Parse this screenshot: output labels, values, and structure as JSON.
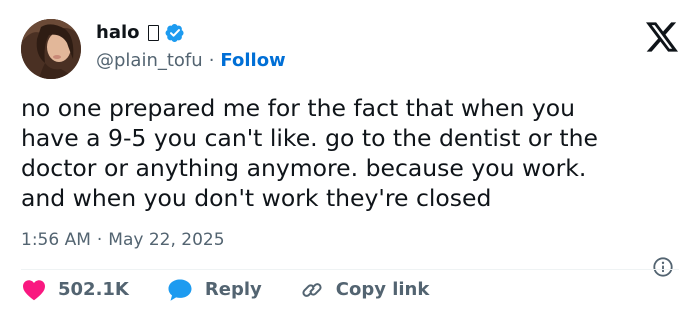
{
  "user": {
    "display_name": "halo",
    "handle": "@plain_tofu",
    "separator": "·",
    "follow_label": "Follow"
  },
  "tweet": {
    "text": "no one prepared me for the fact that when you\nhave a 9-5 you can't like. go to the dentist or the\ndoctor or anything anymore. because you work.\nand when you don't work they're closed",
    "time": "1:56 AM",
    "separator": "·",
    "date": "May 22, 2025"
  },
  "actions": {
    "like_count": "502.1K",
    "reply_label": "Reply",
    "copy_label": "Copy link"
  },
  "colors": {
    "text": "#0f1419",
    "secondary": "#536471",
    "link": "#006fd6",
    "like": "#f91880",
    "reply": "#1d9bf0",
    "verified": "#1d9bf0"
  },
  "icons": [
    "x-logo-icon",
    "verified-badge-icon",
    "info-icon",
    "heart-icon",
    "reply-bubble-icon",
    "link-icon"
  ]
}
